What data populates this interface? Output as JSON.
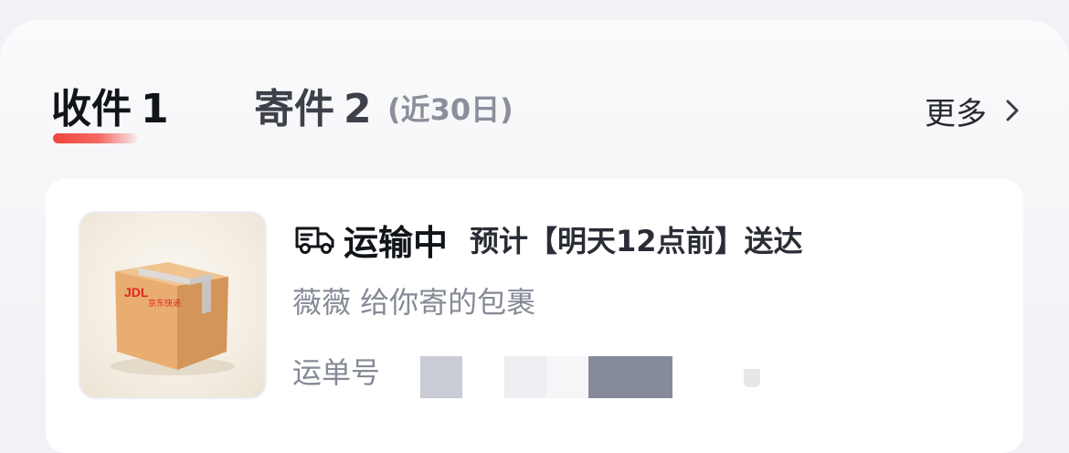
{
  "tabs": {
    "receive": {
      "label": "收件",
      "count": "1",
      "active": true
    },
    "send": {
      "label": "寄件",
      "count": "2",
      "active": false
    },
    "period_note": "(近30日)"
  },
  "more": {
    "label": "更多",
    "icon": "chevron-right-icon"
  },
  "package": {
    "status_icon": "truck-icon",
    "status": "运输中",
    "eta": "预计【明天12点前】送达",
    "sender_line": "薇薇 给你寄的包裹",
    "waybill_label": "运单号",
    "waybill_value_redacted": true,
    "thumbnail": {
      "brand_mark": "JDL",
      "brand_name": "京东快递",
      "brand_color": "#e1251b"
    }
  },
  "colors": {
    "accent": "#f0443c",
    "background": "#f1f2f5",
    "card": "#ffffff",
    "text_primary": "#111418",
    "text_secondary": "#858a96"
  }
}
